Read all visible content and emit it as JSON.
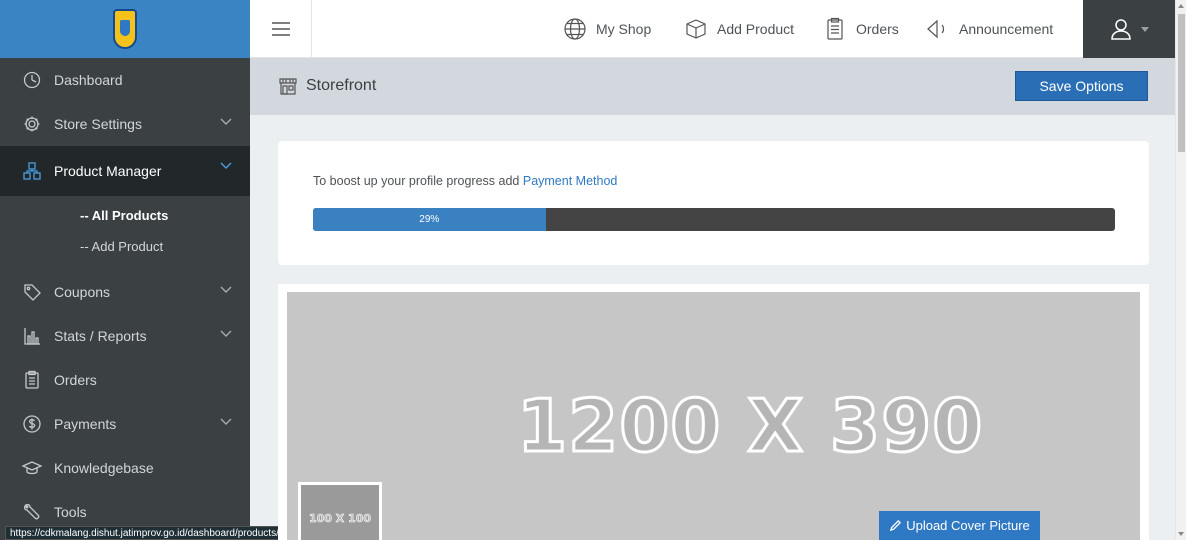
{
  "sidebar": {
    "items": [
      {
        "label": "Dashboard",
        "icon": "dashboard-icon",
        "has_chevron": false
      },
      {
        "label": "Store Settings",
        "icon": "gear-icon",
        "has_chevron": true
      },
      {
        "label": "Product Manager",
        "icon": "product-boxes-icon",
        "has_chevron": true,
        "active": true
      },
      {
        "label": "Coupons",
        "icon": "tag-icon",
        "has_chevron": true
      },
      {
        "label": "Stats / Reports",
        "icon": "bar-chart-icon",
        "has_chevron": true
      },
      {
        "label": "Orders",
        "icon": "clipboard-icon",
        "has_chevron": false
      },
      {
        "label": "Payments",
        "icon": "dollar-icon",
        "has_chevron": true
      },
      {
        "label": "Knowledgebase",
        "icon": "graduation-cap-icon",
        "has_chevron": false
      },
      {
        "label": "Tools",
        "icon": "wrench-icon",
        "has_chevron": false
      }
    ],
    "sub_items": [
      {
        "label": "-- All Products",
        "current": true
      },
      {
        "label": "-- Add Product",
        "current": false
      }
    ]
  },
  "topbar": {
    "links": [
      {
        "label": "My Shop",
        "icon": "globe-icon"
      },
      {
        "label": "Add Product",
        "icon": "box-icon"
      },
      {
        "label": "Orders",
        "icon": "clipboard-icon"
      },
      {
        "label": "Announcement",
        "icon": "megaphone-icon"
      }
    ],
    "user_icon": "user-icon"
  },
  "page": {
    "title": "Storefront",
    "title_icon": "storefront-icon",
    "save_label": "Save Options"
  },
  "progress": {
    "message": "To boost up your profile progress add ",
    "link_text": "Payment Method",
    "percent_label": "29%",
    "percent": 29
  },
  "cover": {
    "placeholder_text": "1200 X 390",
    "thumb_text": "100 X 100",
    "upload_label": "Upload Cover Picture"
  },
  "status_bar": {
    "url": "https://cdkmalang.dishut.jatimprov.go.id/dashboard/products/"
  },
  "colors": {
    "accent": "#2a6fb5",
    "sidebar_bg": "#3b4043",
    "logo_bar": "#3b84c4"
  }
}
